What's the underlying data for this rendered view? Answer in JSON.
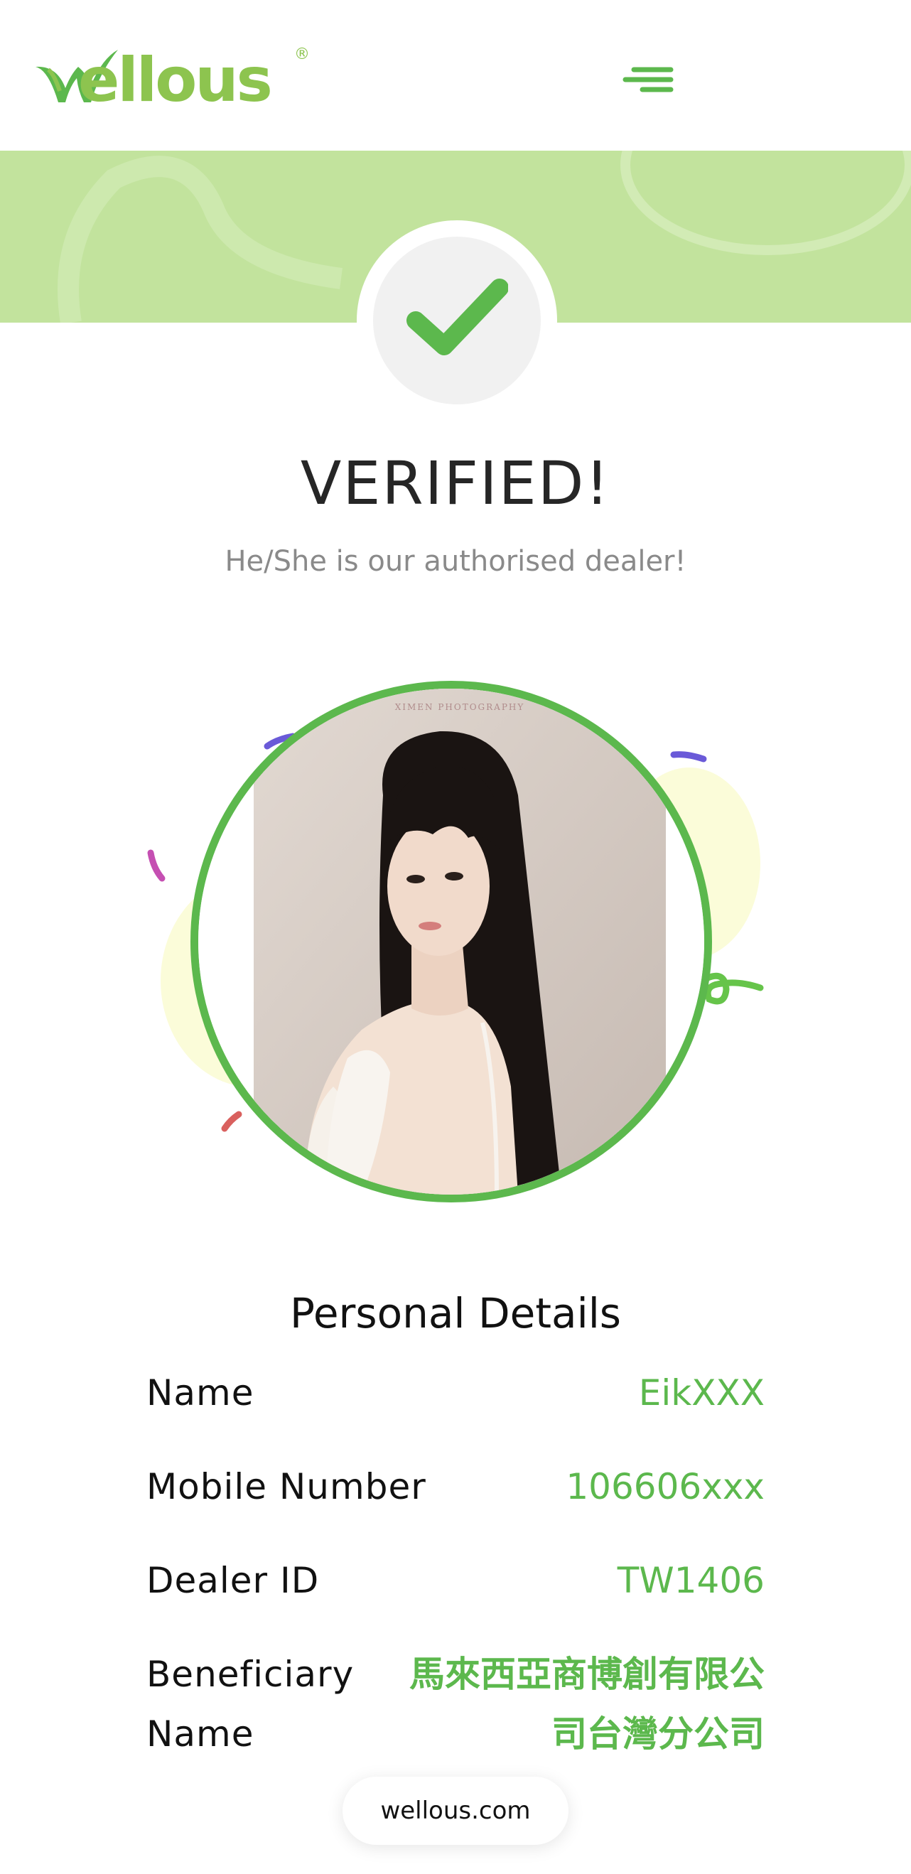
{
  "header": {
    "logo_text": "Wellous",
    "logo_registered_mark": "®",
    "menu_icon": "hamburger-menu-icon"
  },
  "status": {
    "icon": "checkmark-icon",
    "title": "VERIFIED!",
    "subtitle": "He/She is our authorised dealer!"
  },
  "photo": {
    "watermark": "XIMEN PHOTOGRAPHY"
  },
  "details": {
    "title": "Personal Details",
    "rows": [
      {
        "label": "Name",
        "value": "EikXXX"
      },
      {
        "label": "Mobile Number",
        "value": "106606xxx"
      },
      {
        "label": "Dealer ID",
        "value": "TW1406"
      },
      {
        "label_line1": "Beneficiary",
        "label_line2": "Name",
        "value_line1": "馬來西亞商博創有限公",
        "value_line2": "司台灣分公司"
      }
    ]
  },
  "footer": {
    "url": "wellous.com"
  },
  "colors": {
    "brand_green": "#8dc44f",
    "accent_green": "#5cb84d",
    "banner_green": "#c2e39d"
  }
}
